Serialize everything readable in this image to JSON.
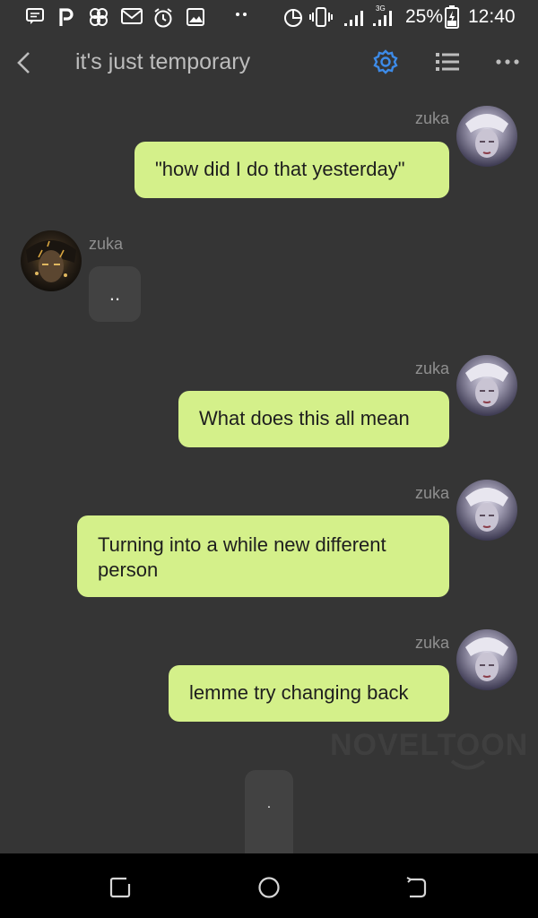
{
  "status_bar": {
    "battery": "25%",
    "time": "12:40",
    "network": "3G",
    "icons": [
      "message-icon",
      "p-icon",
      "pinwheel-icon",
      "gmail-icon",
      "alarm-icon",
      "image-icon",
      "dots-icon",
      "data-saver-icon",
      "vibrate-icon",
      "signal-icon",
      "signal-3g-icon",
      "battery-charging-icon"
    ]
  },
  "header": {
    "title": "it's just temporary",
    "icons": [
      "back-icon",
      "settings-gear-icon",
      "list-icon",
      "more-icon"
    ],
    "accent_color": "#3d8be8"
  },
  "messages": [
    {
      "side": "right",
      "name": "zuka",
      "text": "\"how did I do that yesterday\""
    },
    {
      "side": "left",
      "name": "zuka",
      "text": ".."
    },
    {
      "side": "right",
      "name": "zuka",
      "text": "What does this all mean"
    },
    {
      "side": "right",
      "name": "zuka",
      "text": "Turning into a while new different person"
    },
    {
      "side": "right",
      "name": "zuka",
      "text": "lemme try changing back"
    },
    {
      "side": "center",
      "name": "",
      "text": "."
    }
  ],
  "watermark": "NOVELTOON",
  "bubble_color": "#d4f08a",
  "nav_bar": {
    "icons": [
      "recent-apps-icon",
      "home-icon",
      "back-nav-icon"
    ]
  }
}
